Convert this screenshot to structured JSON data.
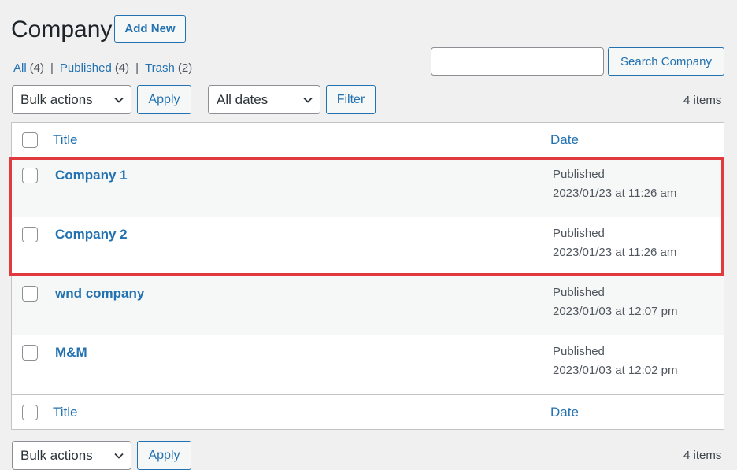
{
  "header": {
    "title": "Company",
    "add_new_label": "Add New"
  },
  "filters": {
    "all": {
      "label": "All",
      "count": "(4)"
    },
    "published": {
      "label": "Published",
      "count": "(4)"
    },
    "trash": {
      "label": "Trash",
      "count": "(2)"
    },
    "separator": "|"
  },
  "search": {
    "value": "",
    "button_label": "Search Company"
  },
  "toolbar_top": {
    "bulk_actions": "Bulk actions",
    "apply_label": "Apply",
    "dates": "All dates",
    "filter_label": "Filter",
    "items_count": "4 items"
  },
  "table": {
    "columns": {
      "title": "Title",
      "date": "Date"
    },
    "rows": [
      {
        "title": "Company 1",
        "status": "Published",
        "date": "2023/01/23 at 11:26 am"
      },
      {
        "title": "Company 2",
        "status": "Published",
        "date": "2023/01/23 at 11:26 am"
      },
      {
        "title": "wnd company",
        "status": "Published",
        "date": "2023/01/03 at 12:07 pm"
      },
      {
        "title": "M&M",
        "status": "Published",
        "date": "2023/01/03 at 12:02 pm"
      }
    ]
  },
  "toolbar_bottom": {
    "bulk_actions": "Bulk actions",
    "apply_label": "Apply",
    "items_count": "4 items"
  },
  "colors": {
    "accent": "#2271b1",
    "highlight": "#e0393e",
    "background": "#f0f0f1"
  }
}
